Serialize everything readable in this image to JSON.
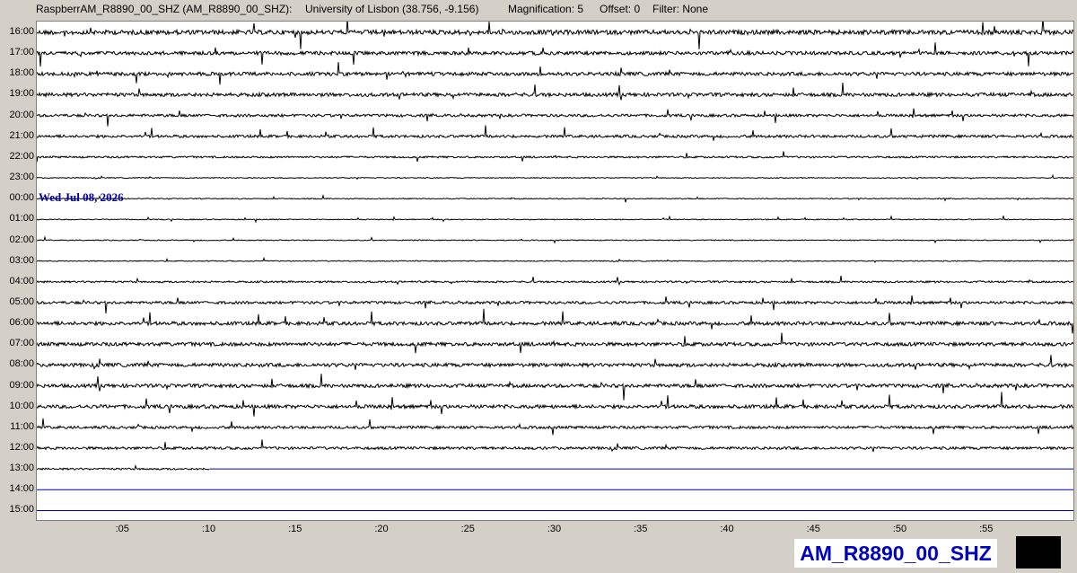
{
  "header": {
    "station": "RaspberrAM_R8890_00_SHZ (AM_R8890_00_SHZ):",
    "location": "University of Lisbon (38.756, -9.156)",
    "magnification": "Magnification: 5",
    "offset": "Offset: 0",
    "filter": "Filter: None"
  },
  "helicorder": {
    "hour_labels": [
      "16:00",
      "17:00",
      "18:00",
      "19:00",
      "20:00",
      "21:00",
      "22:00",
      "23:00",
      "00:00",
      "01:00",
      "02:00",
      "03:00",
      "04:00",
      "05:00",
      "06:00",
      "07:00",
      "08:00",
      "09:00",
      "10:00",
      "11:00",
      "12:00",
      "13:00",
      "14:00",
      "15:00"
    ],
    "minute_labels": [
      ":05",
      ":10",
      ":15",
      ":20",
      ":25",
      ":30",
      ":35",
      ":40",
      ":45",
      ":50",
      ":55"
    ],
    "date_label": "Wed Jul 08, 2026",
    "trace_color": "#000000",
    "future_line_color": "#0000c0",
    "amplitude_levels": [
      5,
      4,
      4,
      4,
      3,
      3,
      2,
      1,
      1,
      1,
      1,
      1,
      2,
      3,
      4,
      4,
      4,
      4,
      4,
      3,
      3,
      2,
      0,
      0
    ],
    "partial_last_row_minutes": 10
  },
  "footer": {
    "station_code": "AM_R8890_00_SHZ"
  }
}
